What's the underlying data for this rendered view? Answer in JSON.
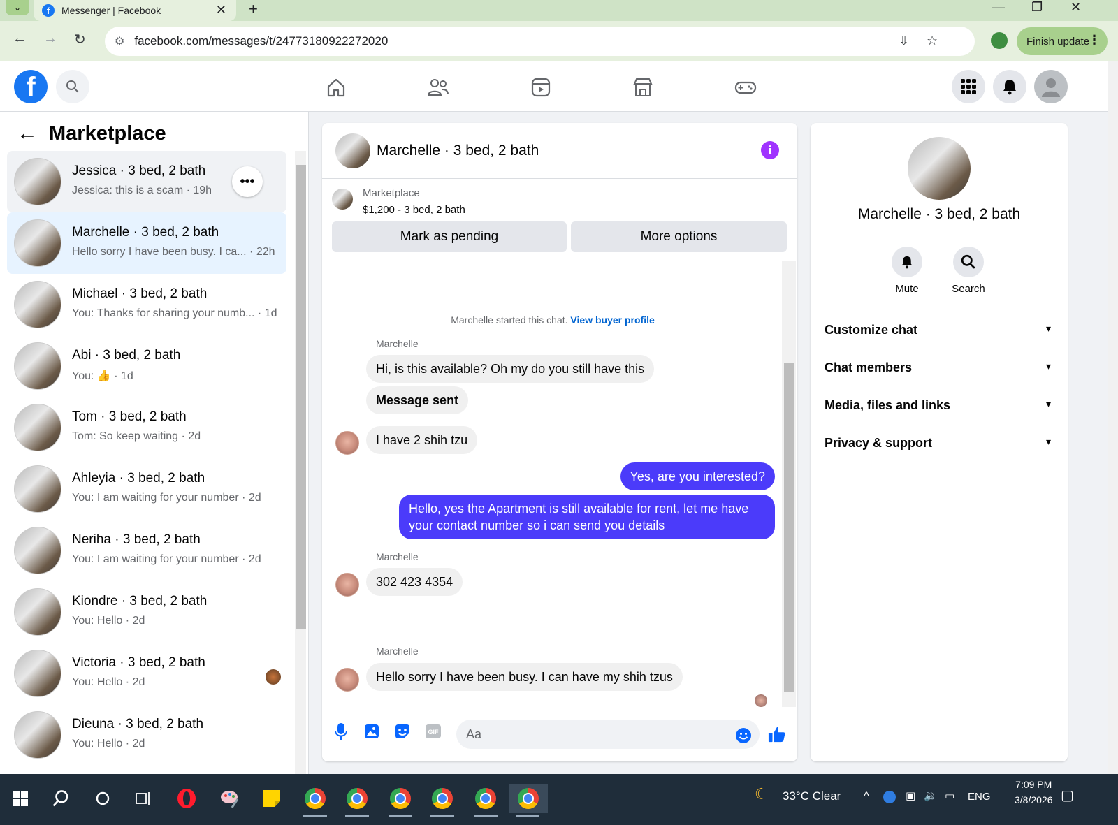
{
  "browser": {
    "tab_title": "Messenger | Facebook",
    "url": "facebook.com/messages/t/24773180922272020",
    "finish_update_label": "Finish update"
  },
  "header": {
    "nav_icons": [
      "home-icon",
      "friends-icon",
      "video-icon",
      "marketplace-icon",
      "gaming-icon"
    ]
  },
  "sidebar": {
    "title": "Marketplace",
    "conversations": [
      {
        "name": "Jessica · 3 bed, 2 bath",
        "preview": "Jessica: this is a scam · 19h",
        "state": "hover"
      },
      {
        "name": "Marchelle · 3 bed, 2 bath",
        "preview": "Hello sorry I have been busy. I ca...  · 22h",
        "state": "active"
      },
      {
        "name": "Michael · 3 bed, 2 bath",
        "preview": "You: Thanks for sharing your numb... · 1d",
        "state": ""
      },
      {
        "name": "Abi · 3 bed, 2 bath",
        "preview": "You: 👍 · 1d",
        "state": ""
      },
      {
        "name": "Tom · 3 bed, 2 bath",
        "preview": "Tom: So keep waiting · 2d",
        "state": ""
      },
      {
        "name": "Ahleyia · 3 bed, 2 bath",
        "preview": "You: I am waiting for your number · 2d",
        "state": ""
      },
      {
        "name": "Neriha · 3 bed, 2 bath",
        "preview": "You: I am waiting for your number · 2d",
        "state": ""
      },
      {
        "name": "Kiondre · 3 bed, 2 bath",
        "preview": "You: Hello · 2d",
        "state": ""
      },
      {
        "name": "Victoria · 3 bed, 2 bath",
        "preview": "You: Hello · 2d",
        "state": ""
      },
      {
        "name": "Dieuna · 3 bed, 2 bath",
        "preview": "You: Hello · 2d",
        "state": ""
      }
    ]
  },
  "chat": {
    "title": "Marchelle · 3 bed, 2 bath",
    "listing_source": "Marketplace",
    "listing_price": "$1,200 - 3 bed, 2 bath",
    "mark_pending_label": "Mark as pending",
    "more_options_label": "More options",
    "system_text": "Marchelle started this chat.",
    "system_link": "View buyer profile",
    "messages": [
      {
        "sender": "Marchelle",
        "text": "Hi, is this available? Oh my do you still have this",
        "dir": "in"
      },
      {
        "sender": "",
        "text": "Message sent",
        "dir": "in"
      },
      {
        "sender": "",
        "text": "I have 2 shih tzu",
        "dir": "in"
      },
      {
        "sender": "You",
        "text": "Yes, are you interested?",
        "dir": "out"
      },
      {
        "sender": "You",
        "text": "Hello, yes the Apartment is still available for rent, let me have",
        "text2": "your contact number so i can send you details",
        "dir": "out"
      },
      {
        "sender": "Marchelle",
        "text": "302 423 4354",
        "dir": "in"
      },
      {
        "sender": "Marchelle",
        "text": "Hello sorry I have been busy. I can have my shih tzus",
        "dir": "in"
      }
    ],
    "input_placeholder": "Aa"
  },
  "details": {
    "name": "Marchelle · 3 bed, 2 bath",
    "mute_label": "Mute",
    "search_label": "Search",
    "sections": [
      "Customize chat",
      "Chat members",
      "Media, files and links",
      "Privacy & support"
    ]
  },
  "taskbar": {
    "weather": "33°C  Clear",
    "lang": "ENG",
    "time": "7:09 PM",
    "date": "3/8/2026"
  },
  "colors": {
    "brand": "#1877f2",
    "outgoing_bubble": "#4b3bfa",
    "active_conv": "#e7f3ff",
    "info_icon": "#a033ff"
  }
}
